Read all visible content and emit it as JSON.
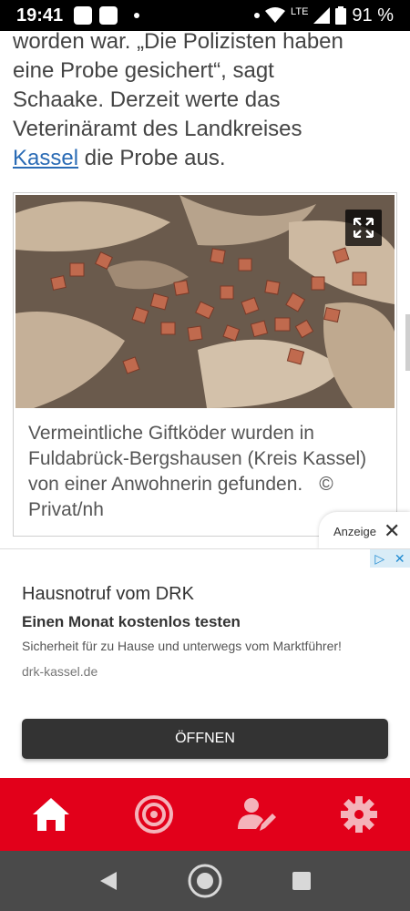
{
  "status": {
    "time": "19:41",
    "battery": "91 %",
    "network": "LTE"
  },
  "article": {
    "line1": "worden war. „Die Polizisten haben",
    "line2": "eine Probe gesichert“, sagt",
    "line3": "Schaake. Derzeit werte das",
    "line4": "Veterinäramt des Landkreises",
    "link": "Kassel",
    "line5_rest": " die Probe aus."
  },
  "figure": {
    "caption": "Vermeintliche Giftköder wurden in Fuldabrück-Bergshausen (Kreis Kassel) von einer Anwohnerin gefunden.",
    "credit": "© Privat/nh"
  },
  "ad": {
    "label": "Anzeige",
    "title": "Hausnotruf vom DRK",
    "headline": "Einen Monat kostenlos testen",
    "description": "Sicherheit für zu Hause und unterwegs vom Marktführer!",
    "url": "drk-kassel.de",
    "button": "ÖFFNEN"
  },
  "colors": {
    "brand_red": "#e2001a",
    "link_blue": "#2a6bb5",
    "sys_nav": "#4a4a4a"
  },
  "nav": {
    "items": [
      "home-icon",
      "target-icon",
      "profile-edit-icon",
      "gear-icon"
    ]
  }
}
